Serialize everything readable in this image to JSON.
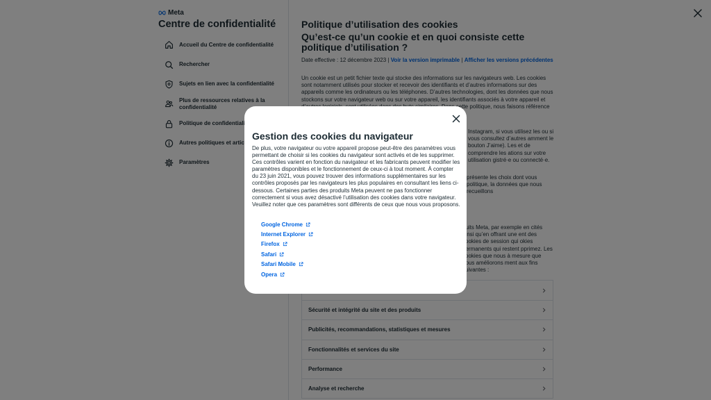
{
  "brand": {
    "logo_text": "Meta"
  },
  "sidebar": {
    "title": "Centre de confidentialité",
    "items": [
      {
        "label": "Accueil du Centre de confidentialité",
        "icon": "home-icon"
      },
      {
        "label": "Rechercher",
        "icon": "search-icon"
      },
      {
        "label": "Sujets en lien avec la confidentialité",
        "icon": "shield-icon"
      },
      {
        "label": "Plus de ressources relatives à la confidentialité",
        "icon": "people-icon"
      },
      {
        "label": "Politique de confidentialité",
        "icon": "lock-icon"
      },
      {
        "label": "Autres politiques et articles",
        "icon": "info-icon"
      },
      {
        "label": "Paramètres",
        "icon": "gear-icon"
      }
    ]
  },
  "main": {
    "heading": "Politique d’utilisation des cookies",
    "subheading": "Qu’est-ce qu’un cookie et en quoi consiste cette politique d’utilisation ?",
    "effective_date": "Date effective : 12 décembre 2023 |",
    "printable_link": "Voir la version imprimable",
    "separator": "|",
    "previous_link": "Afficher les versions précédentes",
    "paragraph_1": "Un cookie est un petit fichier texte qui stocke des informations sur les navigateurs web. Les cookies sont notamment utilisés pour stocker et recevoir des identifiants et d’autres informations sur des appareils comme les ordinateurs ou les téléphones. D’autres technologies, dont les données que nous stockons sur votre navigateur web ou sur votre appareil, les identifiants associés à votre appareil et d’autres logiciels, sont utilisées dans des buts similaires. Dans cette politique, nous faisons référence à ces technologies par le terme",
    "paragraph_2": "Instagram, si vous utilisez les ou si vous consultez d’autres amment le bouton J’aime). Les et de comprendre les ations sur votre utilisation gistré·e ou connecté·e.",
    "paragraph_3": "présente les choix dont vous politique, la données que nous recueillons",
    "paragraph_4": "duits Meta, par exemple en cités ainsi qu’en offrant une ent des cookies de session qui okies permanents qui restent pprimez. Les cookies que nous à mesure que nous améliorons ment aux fins suivantes :",
    "accordion": [
      "",
      "Sécurité et intégrité du site et des produits",
      "Publicités, recommandations, statistiques et mesures",
      "Fonctionnalités et services du site",
      "Performance",
      "Analyse et recherche"
    ]
  },
  "modal": {
    "title": "Gestion des cookies du navigateur",
    "body": "De plus, votre navigateur ou votre appareil propose peut-être des paramètres vous permettant de choisir si les cookies du navigateur sont activés et de les supprimer. Ces contrôles varient en fonction du navigateur et les fabricants peuvent modifier les paramètres disponibles et le fonctionnement de ceux-ci à tout moment. À compter du 23 juin 2021, vous pouvez trouver des informations supplémentaires sur les contrôles proposés par les navigateurs les plus populaires en consultant les liens ci-dessous. Certaines parties des produits Meta peuvent ne pas fonctionner correctement si vous avez désactivé l’utilisation des cookies dans votre navigateur. Veuillez noter que ces paramètres sont différents de ceux que nous vous proposons.",
    "links": [
      "Google Chrome",
      "Internet Explorer",
      "Firefox",
      "Safari",
      "Safari Mobile",
      "Opera"
    ]
  },
  "colors": {
    "link": "#0064e0",
    "text": "#1c2b33",
    "overlay": "rgba(0,0,0,0.5)"
  }
}
